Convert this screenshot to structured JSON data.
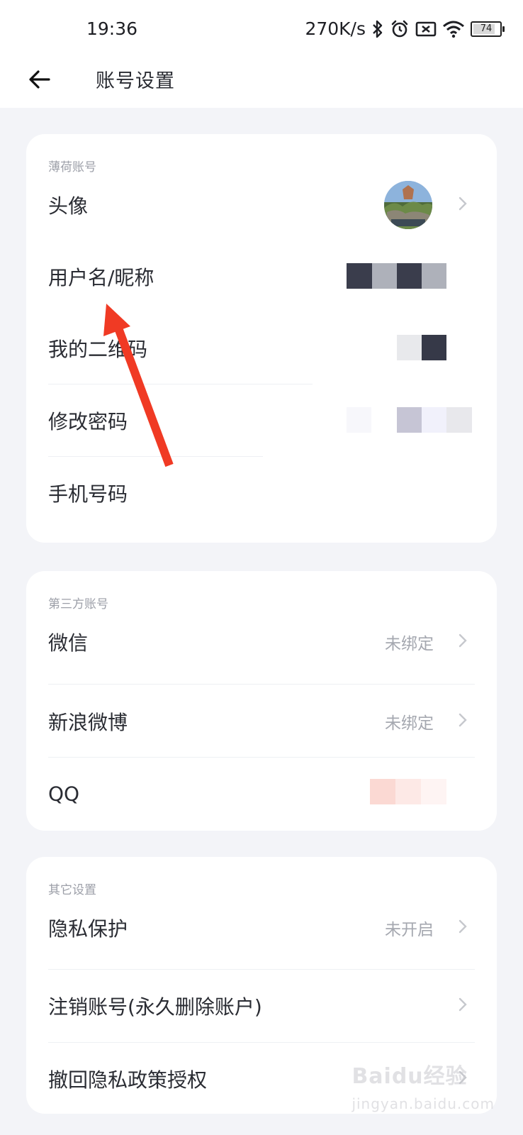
{
  "status_bar": {
    "time": "19:36",
    "network_speed": "270K/s",
    "battery_level": "74",
    "icons": [
      "bluetooth-icon",
      "alarm-icon",
      "sim-off-icon",
      "wifi-icon",
      "battery-icon"
    ]
  },
  "navbar": {
    "back_icon": "arrow-left-icon",
    "title": "账号设置"
  },
  "section_mint": {
    "label": "薄荷账号",
    "rows": [
      {
        "label": "头像"
      },
      {
        "label": "用户名/昵称"
      },
      {
        "label": "我的二维码"
      },
      {
        "label": "修改密码"
      },
      {
        "label": "手机号码"
      }
    ]
  },
  "section_third_party": {
    "label": "第三方账号",
    "rows": [
      {
        "label": "微信",
        "value": "未绑定"
      },
      {
        "label": "新浪微博",
        "value": "未绑定"
      },
      {
        "label": "QQ"
      }
    ]
  },
  "section_other": {
    "label": "其它设置",
    "rows": [
      {
        "label": "隐私保护",
        "value": "未开启"
      },
      {
        "label": "注销账号(永久删除账户)"
      },
      {
        "label": "撤回隐私政策授权"
      }
    ]
  },
  "watermark": {
    "text": "Baidu经验",
    "sub": "jingyan.baidu.com"
  },
  "colors": {
    "background": "#f3f4f8",
    "card": "#ffffff",
    "annotation_arrow": "#f03a24"
  }
}
